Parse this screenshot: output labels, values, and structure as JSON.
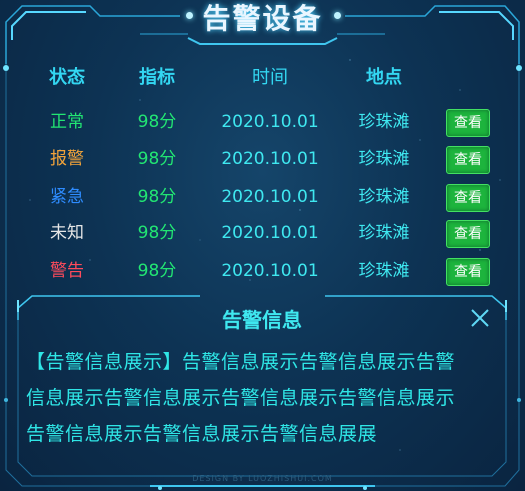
{
  "title": "告警设备",
  "colors": {
    "normal": "#22e673",
    "alarm": "#f3a43a",
    "urgent": "#2e8cff",
    "unknown": "#e6e6e6",
    "warning": "#ff4b5c",
    "button": "#1db43d"
  },
  "table": {
    "headers": [
      "状态",
      "指标",
      "时间",
      "地点"
    ],
    "rows": [
      {
        "status": "正常",
        "metric": "98分",
        "time": "2020.10.01",
        "location": "珍珠滩",
        "action": "查看"
      },
      {
        "status": "报警",
        "metric": "98分",
        "time": "2020.10.01",
        "location": "珍珠滩",
        "action": "查看"
      },
      {
        "status": "紧急",
        "metric": "98分",
        "time": "2020.10.01",
        "location": "珍珠滩",
        "action": "查看"
      },
      {
        "status": "未知",
        "metric": "98分",
        "time": "2020.10.01",
        "location": "珍珠滩",
        "action": "查看"
      },
      {
        "status": "警告",
        "metric": "98分",
        "time": "2020.10.01",
        "location": "珍珠滩",
        "action": "查看"
      }
    ]
  },
  "alert_panel": {
    "title": "告警信息",
    "close_icon": "close-icon",
    "lines": [
      "【告警信息展示】告警信息展示告警信息展示告警",
      "信息展示告警信息展示告警信息展示告警信息展示",
      "告警信息展示告警信息展示告警信息展展"
    ]
  },
  "footer": "DESIGN BY LUOZHISHUI.COM"
}
